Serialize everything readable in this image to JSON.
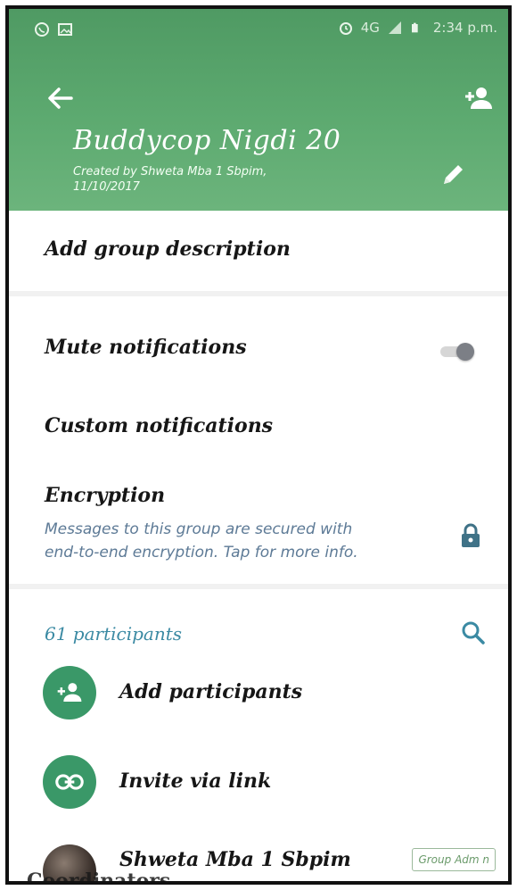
{
  "status_bar": {
    "time": "2:34 p.m.",
    "network": "4G",
    "left_icons": [
      "whatsapp-icon",
      "gallery-icon"
    ],
    "right_icons": [
      "alarm-icon",
      "signal-icon",
      "battery-icon"
    ]
  },
  "header": {
    "title": "Buddycop Nigdi 20",
    "subtitle_line1": "Created by Shweta Mba 1 Sbpim,",
    "subtitle_line2": "11/10/2017",
    "accent_color": "#5da86f"
  },
  "description": {
    "label": "Add group description"
  },
  "settings": {
    "mute_label": "Mute notifications",
    "mute_enabled": false,
    "custom_label": "Custom notifications",
    "encryption_title": "Encryption",
    "encryption_line1": "Messages to this group are secured with",
    "encryption_line2": "end-to-end encryption. Tap for more info."
  },
  "participants": {
    "count_label": "61 participants",
    "add_label": "Add participants",
    "invite_label": "Invite via link",
    "members": [
      {
        "name": "Shweta Mba 1 Sbpim",
        "badge": "Group Adm n"
      }
    ],
    "overlay_text": "Coordinators"
  }
}
